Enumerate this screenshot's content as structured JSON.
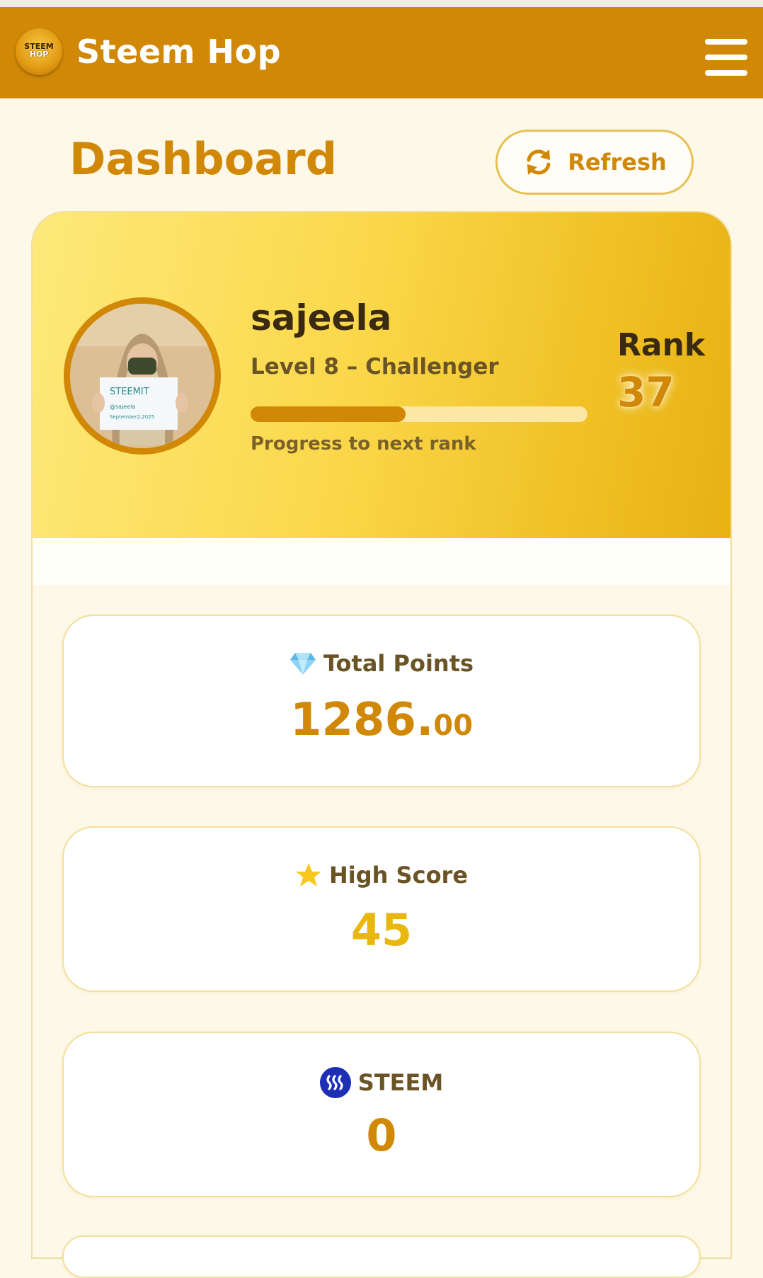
{
  "header": {
    "app_title": "Steem Hop",
    "logo_text_1": "STEEM",
    "logo_text_2": "HOP",
    "logo_icon": "steem-hop-logo",
    "menu_icon": "hamburger-menu-icon"
  },
  "dashboard": {
    "title": "Dashboard",
    "refresh_label": "Refresh",
    "refresh_icon": "refresh-icon"
  },
  "profile": {
    "username": "sajeela",
    "level": "Level 8 – Challenger",
    "progress_label": "Progress to next rank",
    "progress_fraction": 0.46,
    "rank_label": "Rank",
    "rank_value": "37",
    "avatar_sign_text_1": "STEEMIT",
    "avatar_sign_text_2": "@sajeela",
    "avatar_sign_text_3": "September2,2025"
  },
  "stats": {
    "total_points": {
      "icon": "gem-icon",
      "label": "Total Points",
      "value_int": "1286.",
      "value_dec": "00"
    },
    "high_score": {
      "icon": "star-icon",
      "label": "High Score",
      "value": "45"
    },
    "steem": {
      "icon": "steem-logo-icon",
      "label": "STEEM",
      "value": "0"
    }
  },
  "colors": {
    "brand": "#d18806",
    "hero_start": "#fde97a",
    "hero_end": "#e7b112",
    "background": "#fdf8e8",
    "steem_blue": "#1d2fb5"
  }
}
